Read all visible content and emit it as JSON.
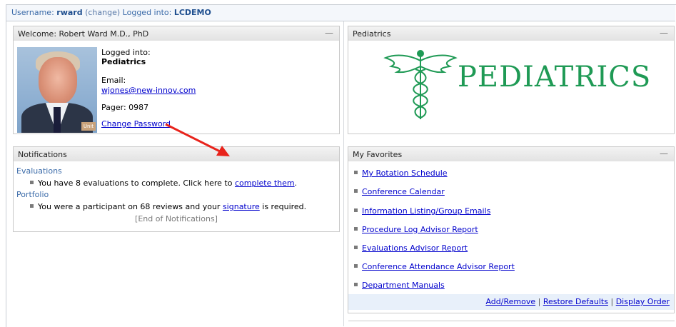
{
  "topbar": {
    "username_label": "Username:",
    "username": "rward",
    "change": "(change)",
    "logged_into_label": "Logged into:",
    "logged_into": "LCDEMO"
  },
  "welcome": {
    "title": "Welcome: Robert Ward M.D., PhD",
    "minimize": "—",
    "photo_badge": "Unit",
    "logged_into_label": "Logged into:",
    "logged_into_value": "Pediatrics",
    "email_label": "Email:",
    "email": "wjones@new-innov.com",
    "pager": "Pager: 0987",
    "change_password": "Change Password"
  },
  "notifications": {
    "title": "Notifications",
    "sections": [
      {
        "heading": "Evaluations",
        "item_text": "You have 8 evaluations to complete. Click here to ",
        "item_link": "complete them",
        "item_after": "."
      },
      {
        "heading": "Portfolio",
        "item_text": "You were a participant on 68 reviews and your ",
        "item_link": "signature",
        "item_after": " is required."
      }
    ],
    "end": "[End of Notifications]"
  },
  "pediatrics": {
    "title": "Pediatrics",
    "minimize": "—",
    "logo_text": "PEDIATRICS",
    "logo_color": "#1f9a55"
  },
  "favorites": {
    "title": "My Favorites",
    "minimize": "—",
    "items": [
      "My Rotation Schedule",
      "Conference Calendar",
      "Information Listing/Group Emails",
      "Procedure Log Advisor Report",
      "Evaluations Advisor Report",
      "Conference Attendance Advisor Report",
      "Department Manuals"
    ],
    "footer": {
      "add_remove": "Add/Remove",
      "restore_defaults": "Restore Defaults",
      "display_order": "Display Order",
      "separator": " | "
    }
  },
  "annotation": {
    "arrow_color": "#e8231b"
  }
}
